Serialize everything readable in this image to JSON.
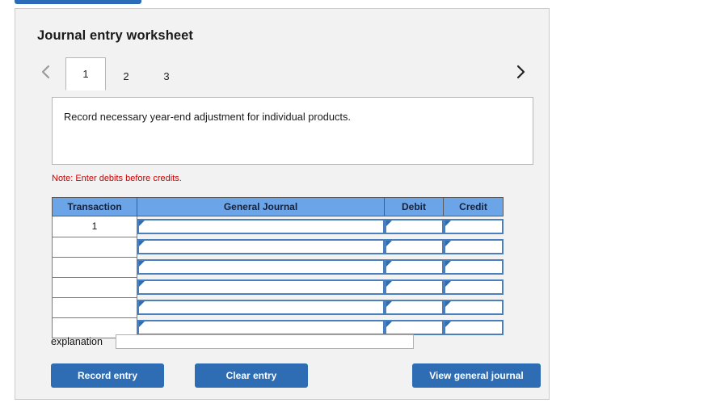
{
  "top_bar": {
    "label": ""
  },
  "panel": {
    "title": "Journal entry worksheet",
    "nav": {
      "prev_icon": "chevron-left-icon",
      "next_icon": "chevron-right-icon"
    },
    "tabs": [
      {
        "label": "1",
        "active": true
      },
      {
        "label": "2",
        "active": false
      },
      {
        "label": "3",
        "active": false
      }
    ],
    "description": "Record necessary year-end adjustment for individual products.",
    "note": "Note: Enter debits before credits.",
    "table": {
      "columns": [
        "Transaction",
        "General Journal",
        "Debit",
        "Credit"
      ],
      "rows": [
        {
          "transaction": "1",
          "general_journal": "",
          "debit": "",
          "credit": ""
        },
        {
          "transaction": "",
          "general_journal": "",
          "debit": "",
          "credit": ""
        },
        {
          "transaction": "",
          "general_journal": "",
          "debit": "",
          "credit": ""
        },
        {
          "transaction": "",
          "general_journal": "",
          "debit": "",
          "credit": ""
        },
        {
          "transaction": "",
          "general_journal": "",
          "debit": "",
          "credit": ""
        },
        {
          "transaction": "",
          "general_journal": "",
          "debit": "",
          "credit": ""
        }
      ]
    },
    "explanation": {
      "label": "explanation",
      "value": "",
      "placeholder": ""
    },
    "buttons": {
      "record": "Record entry",
      "clear": "Clear entry",
      "view": "View general journal"
    }
  },
  "colors": {
    "header_blue": "#6ba5e7",
    "button_blue": "#2e6db4",
    "note_red": "#cc0000",
    "panel_bg": "#f2f2f2",
    "cell_border_blue": "#4a7fbd"
  }
}
